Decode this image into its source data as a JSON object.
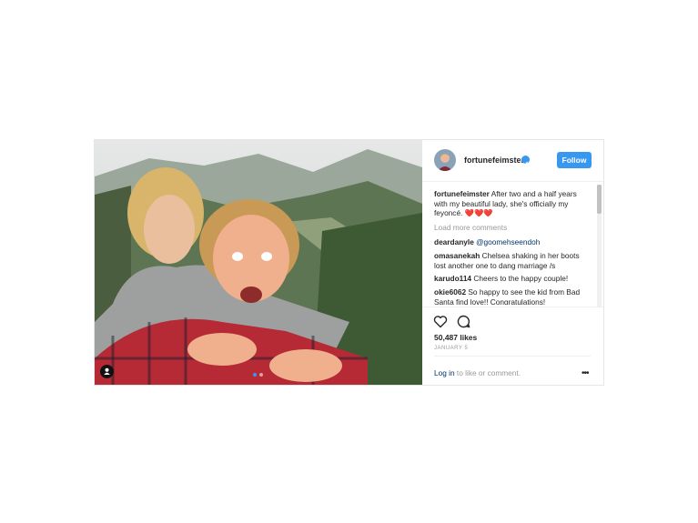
{
  "post": {
    "username": "fortunefeimster",
    "follow_label": "Follow",
    "caption_user": "fortunefeimster",
    "caption_text": "After two and a half years with my beautiful lady, she's officially my feyoncé. ❤️❤️❤️",
    "load_more": "Load more comments",
    "comments": [
      {
        "user": "deardanyle",
        "text": "@goomehseendoh"
      },
      {
        "user": "omasanekah",
        "text": "Chelsea shaking in her boots lost another one to dang marriage /s"
      },
      {
        "user": "karudo114",
        "text": "Cheers to the happy couple!"
      },
      {
        "user": "okie6062",
        "text": "So happy to see the kid from Bad Santa find love!! Congratulations!"
      }
    ],
    "likes": "50,487 likes",
    "date": "JANUARY 5",
    "login_link": "Log in",
    "login_text": " to like or comment.",
    "more_icon": "•••"
  },
  "icons": [
    "heart-icon",
    "comment-icon",
    "verified-icon",
    "user-tag-icon",
    "more-options-icon"
  ],
  "colors": {
    "accent": "#3897f0",
    "link": "#003569",
    "muted": "#999999"
  }
}
